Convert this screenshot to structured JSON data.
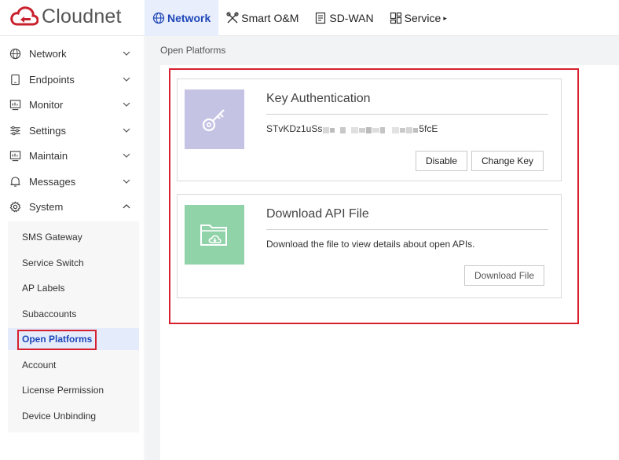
{
  "app": {
    "name": "Cloudnet"
  },
  "topnav": [
    {
      "label": "Network",
      "icon": "globe-icon",
      "active": true
    },
    {
      "label": "Smart O&M",
      "icon": "tools-icon",
      "active": false
    },
    {
      "label": "SD-WAN",
      "icon": "document-icon",
      "active": false
    },
    {
      "label": "Service",
      "icon": "grid-icon",
      "active": false,
      "caret": "▸"
    }
  ],
  "sidebar": {
    "items": [
      {
        "label": "Network",
        "icon": "globe-icon",
        "expanded": false
      },
      {
        "label": "Endpoints",
        "icon": "tablet-icon",
        "expanded": false
      },
      {
        "label": "Monitor",
        "icon": "monitor-chart-icon",
        "expanded": false
      },
      {
        "label": "Settings",
        "icon": "sliders-icon",
        "expanded": false
      },
      {
        "label": "Maintain",
        "icon": "monitor-chart-icon",
        "expanded": false
      },
      {
        "label": "Messages",
        "icon": "bell-icon",
        "expanded": false
      },
      {
        "label": "System",
        "icon": "gear-icon",
        "expanded": true
      }
    ],
    "submenu": [
      {
        "label": "SMS Gateway"
      },
      {
        "label": "Service Switch"
      },
      {
        "label": "AP Labels"
      },
      {
        "label": "Subaccounts"
      },
      {
        "label": "Open Platforms",
        "active": true
      },
      {
        "label": "Account"
      },
      {
        "label": "License Permission"
      },
      {
        "label": "Device Unbinding"
      }
    ]
  },
  "breadcrumb": "Open Platforms",
  "cards": {
    "key_auth": {
      "title": "Key Authentication",
      "key_prefix": "STvKDz1uSs",
      "key_suffix": "5fcE",
      "disable_label": "Disable",
      "change_key_label": "Change Key",
      "icon": "key-icon"
    },
    "api_file": {
      "title": "Download API File",
      "description": "Download the file to view details about open APIs.",
      "download_label": "Download File",
      "icon": "folder-download-icon"
    }
  },
  "colors": {
    "accent": "#1f47b8",
    "highlight_red": "#d7202e",
    "key_thumb": "#c5c3e4",
    "api_thumb": "#91d3a9"
  }
}
